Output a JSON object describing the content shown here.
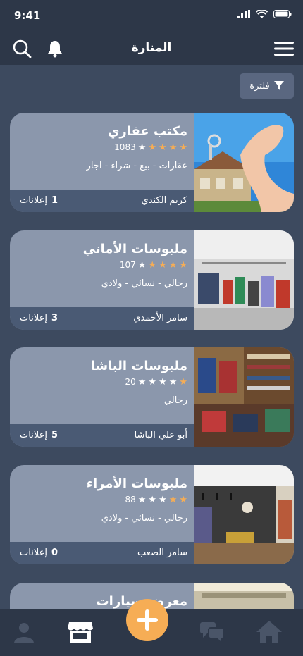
{
  "status": {
    "time": "9:41"
  },
  "header": {
    "title": "المنارة"
  },
  "filter": {
    "label": "فلترة"
  },
  "shops": [
    {
      "name": "مكتب عقاري",
      "rating": 4,
      "reviews": "1083",
      "tags": "عقارات - بيع - شراء - اجار",
      "owner": "كريم الكندي",
      "ads_count": "1",
      "ads_label": "إعلانات"
    },
    {
      "name": "ملبوسات الأماني",
      "rating": 4,
      "reviews": "107",
      "tags": "رجالي - نسائي - ولادي",
      "owner": "سامر الأحمدي",
      "ads_count": "3",
      "ads_label": "إعلانات"
    },
    {
      "name": "ملبوسات الباشا",
      "rating": 1,
      "reviews": "20",
      "tags": "رجالي",
      "owner": "أبو علي الباشا",
      "ads_count": "5",
      "ads_label": "إعلانات"
    },
    {
      "name": "ملبوسات الأمراء",
      "rating": 2,
      "reviews": "88",
      "tags": "رجالي - نسائي - ولادي",
      "owner": "سامر الصعب",
      "ads_count": "0",
      "ads_label": "إعلانات"
    },
    {
      "name": "معرض سيارات"
    }
  ],
  "nav": {
    "active": "store-icon"
  },
  "colors": {
    "accent": "#f6ad55",
    "header": "#2d3748",
    "card": "#8b97ac",
    "card_footer": "#4a5a74"
  }
}
